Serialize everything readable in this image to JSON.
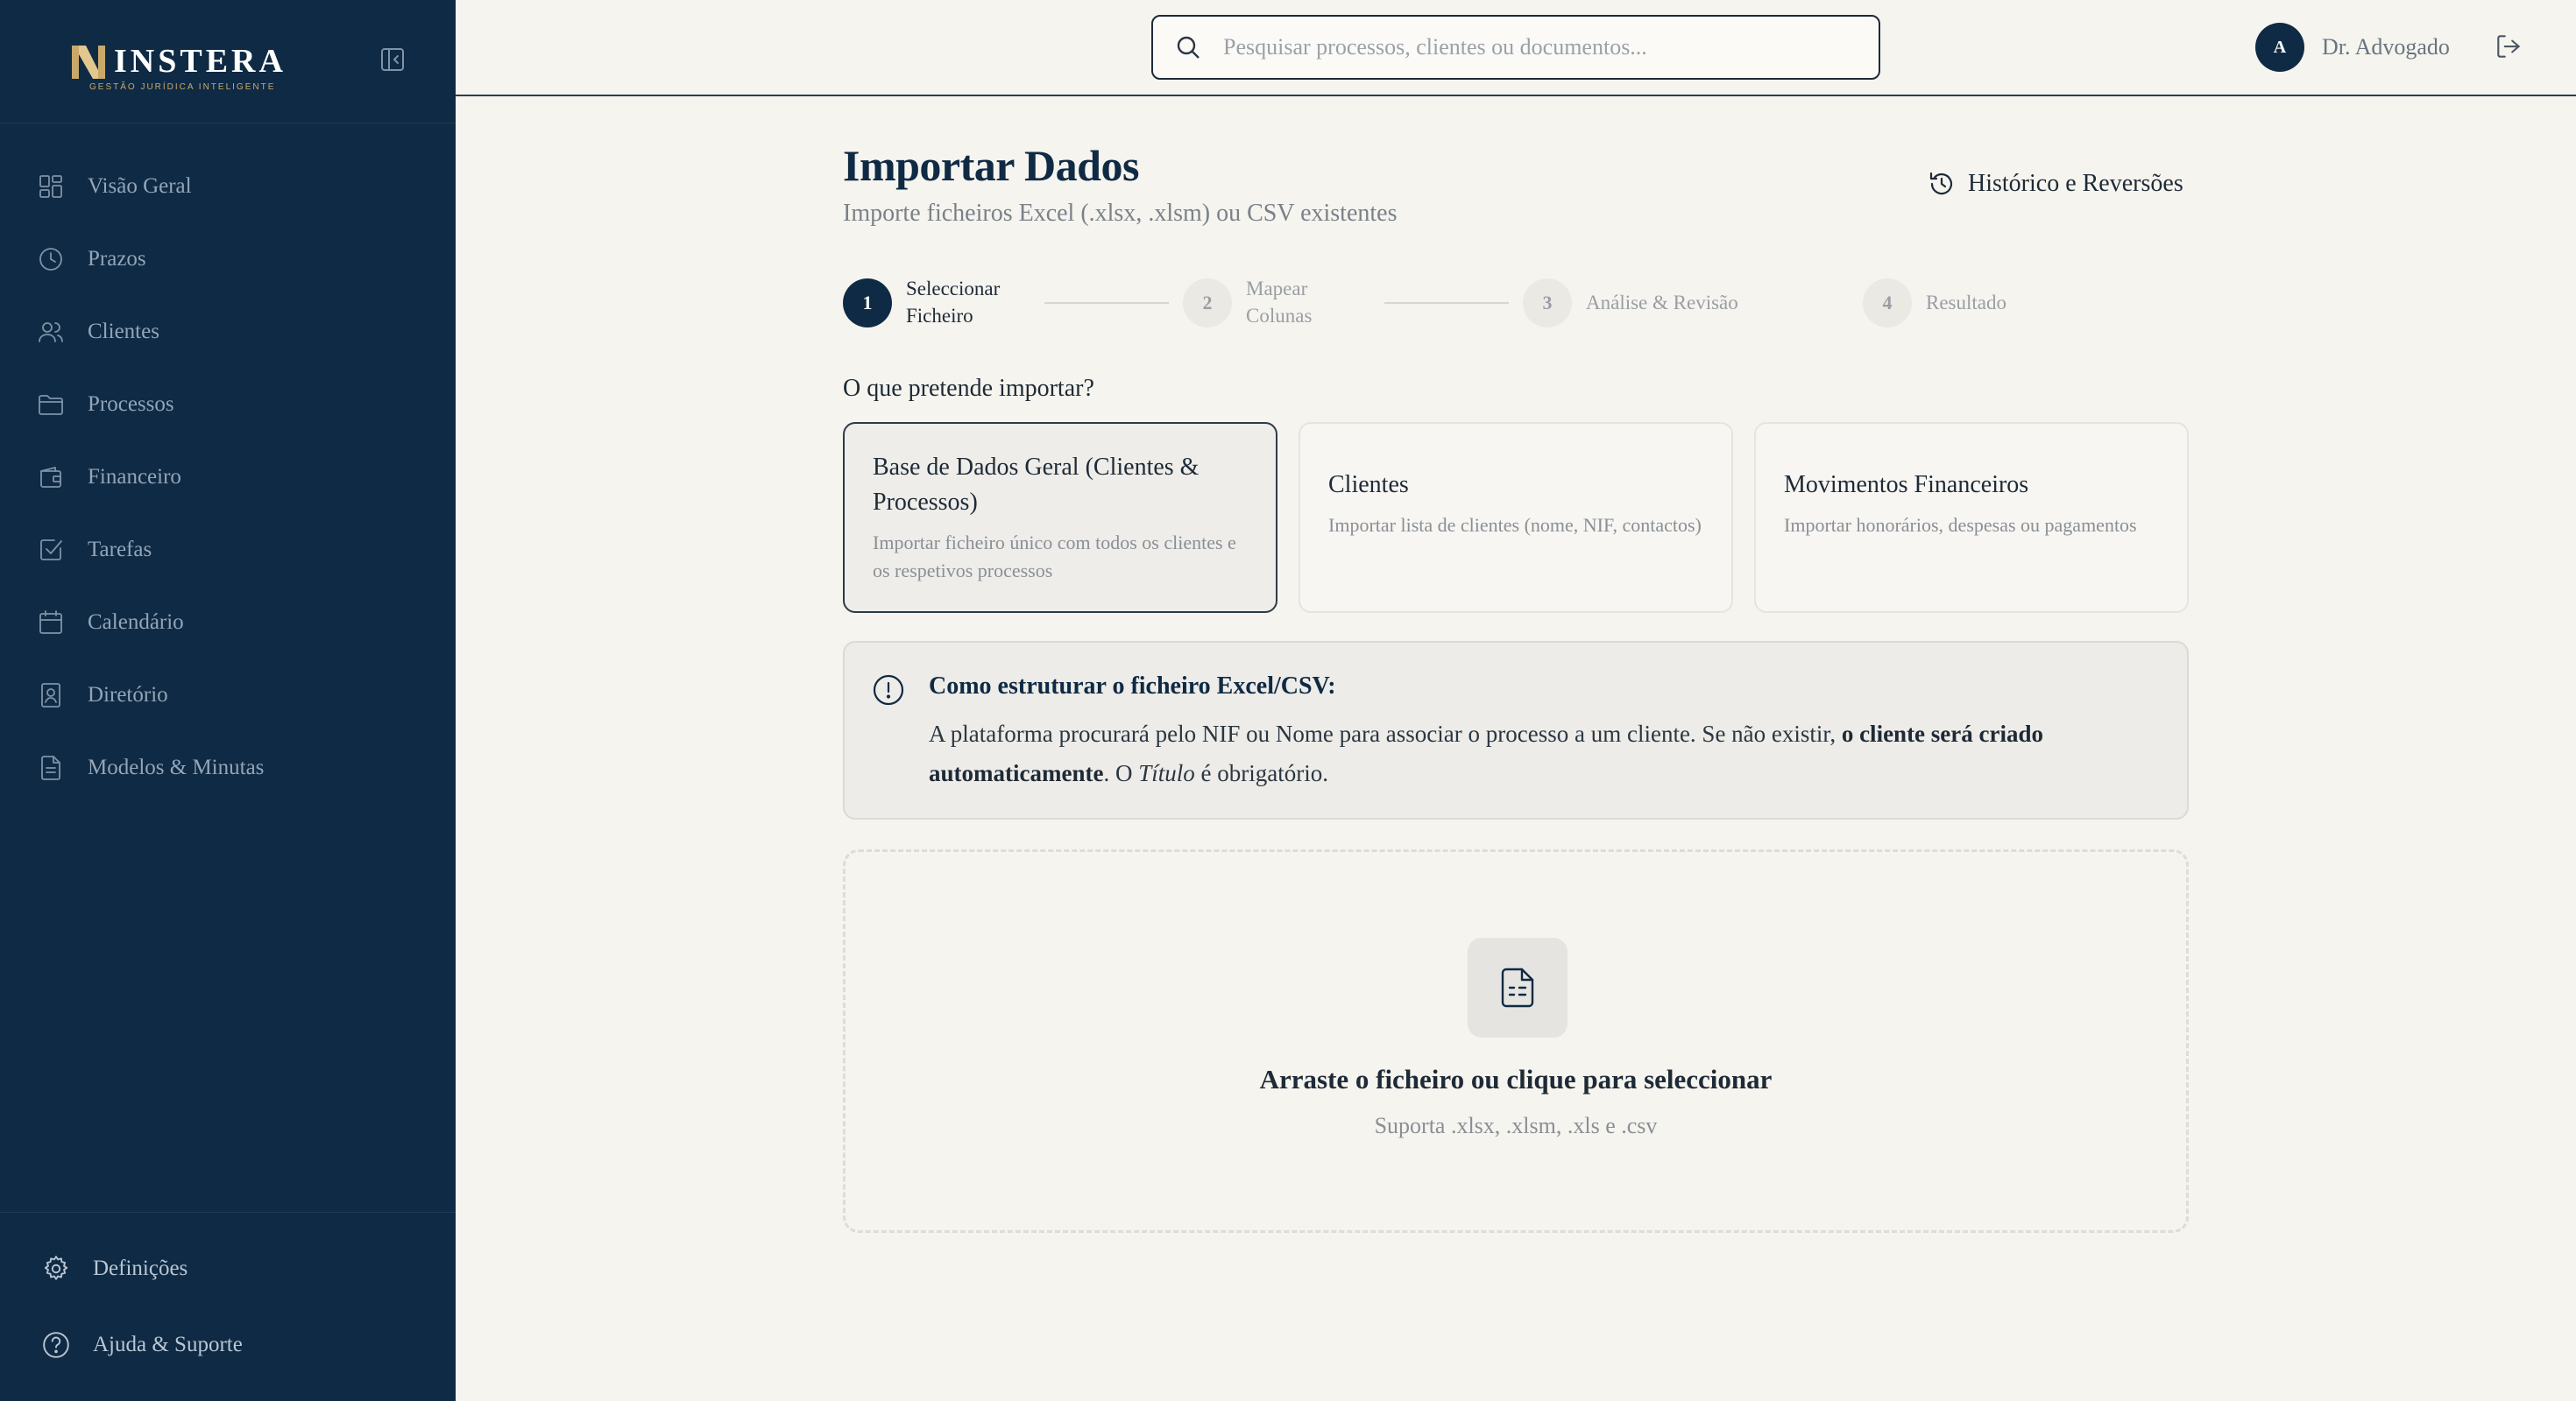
{
  "brand": {
    "name": "INSTERA",
    "tagline": "GESTÃO JURÍDICA INTELIGENTE"
  },
  "sidebar": {
    "items": [
      {
        "label": "Visão Geral",
        "icon": "grid-icon"
      },
      {
        "label": "Prazos",
        "icon": "clock-icon"
      },
      {
        "label": "Clientes",
        "icon": "users-icon"
      },
      {
        "label": "Processos",
        "icon": "folder-icon"
      },
      {
        "label": "Financeiro",
        "icon": "wallet-icon"
      },
      {
        "label": "Tarefas",
        "icon": "checkbox-icon"
      },
      {
        "label": "Calendário",
        "icon": "calendar-icon"
      },
      {
        "label": "Diretório",
        "icon": "contact-icon"
      },
      {
        "label": "Modelos & Minutas",
        "icon": "document-icon"
      }
    ],
    "footer": [
      {
        "label": "Definições",
        "icon": "gear-icon"
      },
      {
        "label": "Ajuda & Suporte",
        "icon": "help-icon"
      }
    ]
  },
  "header": {
    "search_placeholder": "Pesquisar processos, clientes ou documentos...",
    "search_value": "",
    "avatar_initial": "A",
    "user_name": "Dr. Advogado"
  },
  "main": {
    "title": "Importar Dados",
    "subtitle": "Importe ficheiros Excel (.xlsx, .xlsm) ou CSV existentes",
    "history_label": "Histórico e Reversões",
    "steps": [
      {
        "number": "1",
        "label_line1": "Seleccionar",
        "label_line2": "Ficheiro",
        "active": true
      },
      {
        "number": "2",
        "label_line1": "Mapear",
        "label_line2": "Colunas",
        "active": false
      },
      {
        "number": "3",
        "label_line1": "Análise & Revisão",
        "label_line2": "",
        "active": false
      },
      {
        "number": "4",
        "label_line1": "Resultado",
        "label_line2": "",
        "active": false
      }
    ],
    "question": "O que pretende importar?",
    "cards": [
      {
        "title": "Base de Dados Geral (Clientes & Processos)",
        "description": "Importar ficheiro único com todos os clientes e os respetivos processos",
        "selected": true
      },
      {
        "title": "Clientes",
        "description": "Importar lista de clientes (nome, NIF, contactos)",
        "selected": false
      },
      {
        "title": "Movimentos Financeiros",
        "description": "Importar honorários, despesas ou pagamentos",
        "selected": false
      }
    ],
    "info": {
      "title": "Como estruturar o ficheiro Excel/CSV:",
      "text_1": "A plataforma procurará pelo NIF ou Nome para associar o processo a um cliente. Se não existir, ",
      "bold_1": "o cliente será criado automaticamente",
      "text_2": ". O ",
      "italic_1": "Título",
      "text_3": " é obrigatório."
    },
    "dropzone": {
      "title": "Arraste o ficheiro ou clique para seleccionar",
      "subtitle": "Suporta .xlsx, .xlsm, .xls e .csv"
    }
  },
  "colors": {
    "sidebar_bg": "#0f2a44",
    "accent_gold": "#c8a96a",
    "page_bg": "#f5f4ef"
  }
}
